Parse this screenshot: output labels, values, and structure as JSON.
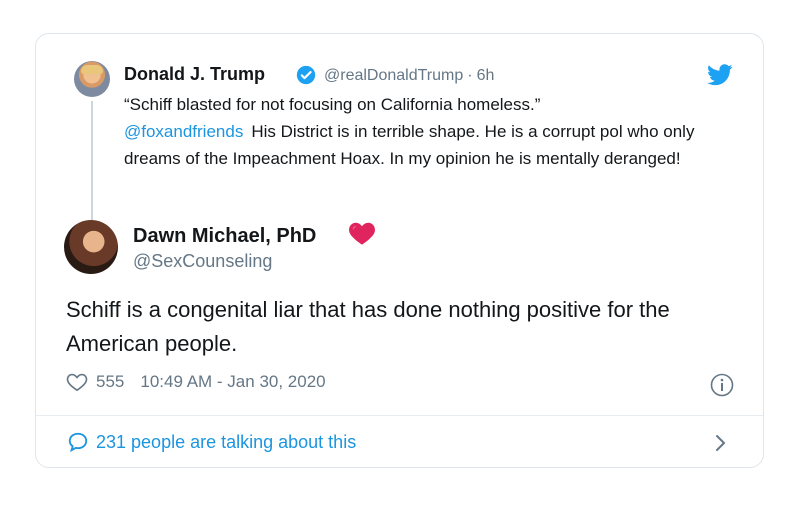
{
  "quoted_tweet": {
    "name": "Donald J. Trump",
    "handle": "@realDonaldTrump",
    "separator": "·",
    "time": "6h",
    "line1": "“Schiff blasted for not focusing on California homeless.”",
    "mention": "@foxandfriends",
    "line2": "His District is in terrible shape. He is a corrupt pol who only dreams of the Impeachment Hoax. In my opinion he is mentally deranged!",
    "icons": {
      "verified": "verified-badge-icon",
      "platform": "twitter-bird-icon"
    }
  },
  "reply_tweet": {
    "name": "Dawn Michael, PhD",
    "handle": "@SexCounseling",
    "text": "Schiff is a congenital liar that has done nothing positive for the American people.",
    "likes": "555",
    "timestamp": "10:49 AM - Jan 30, 2020",
    "icons": {
      "heart_emoji": "heart-emoji-icon",
      "like": "heart-outline-icon",
      "info": "info-icon"
    }
  },
  "footer": {
    "talk_text": "231 people are talking about this",
    "icons": {
      "comment": "speech-bubble-icon",
      "next": "chevron-right-icon"
    }
  },
  "colors": {
    "accent": "#1b95e0",
    "muted": "#657786",
    "border": "#dfe5ea",
    "heart": "#e0245e"
  }
}
